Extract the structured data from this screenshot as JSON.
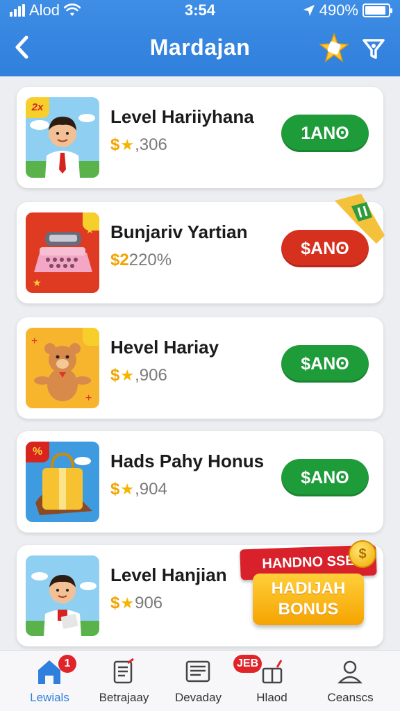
{
  "status_bar": {
    "carrier": "Alod",
    "time": "3:54",
    "battery": "490%",
    "battery_level": 0.9
  },
  "header": {
    "title": "Mardajan",
    "back_icon": "chevron-left-icon",
    "right_icons": [
      "star-sparkle-icon",
      "filter-icon"
    ]
  },
  "items": [
    {
      "name": "Level Hariiyhana",
      "score_prefix": "$",
      "score_value": ",306",
      "action": "1ANʘ",
      "action_color": "#1f9c3a",
      "thumb_tag": "2x"
    },
    {
      "name": "Bunjariv Yartian",
      "score_prefix": "$",
      "score_value": "220%",
      "score_digit": "2",
      "action": "$ANʘ",
      "action_color": "#d6301f"
    },
    {
      "name": "Hevel Hariay",
      "score_prefix": "$",
      "score_value": ",906",
      "action": "$ANʘ",
      "action_color": "#1f9c3a"
    },
    {
      "name": "Hads Pahy Honus",
      "score_prefix": "$",
      "score_value": ",904",
      "action": "$ANʘ",
      "action_color": "#1f9c3a",
      "thumb_tag": "%"
    },
    {
      "name": "Level Hanjian",
      "score_prefix": "$",
      "score_value": "906"
    }
  ],
  "bonus_banner": {
    "top_text": "HANDNO SSE",
    "line1": "HADIJAH",
    "line2": "BONUS",
    "coin_symbol": "$"
  },
  "tabs": [
    {
      "label": "Lewials",
      "icon": "home-icon",
      "badge": "1",
      "active": true
    },
    {
      "label": "Betrajaay",
      "icon": "clipboard-icon"
    },
    {
      "label": "Devaday",
      "icon": "document-icon"
    },
    {
      "label": "Hlaod",
      "icon": "gift-box-icon",
      "badge": "JEB"
    },
    {
      "label": "Ceanscs",
      "icon": "user-icon"
    }
  ]
}
